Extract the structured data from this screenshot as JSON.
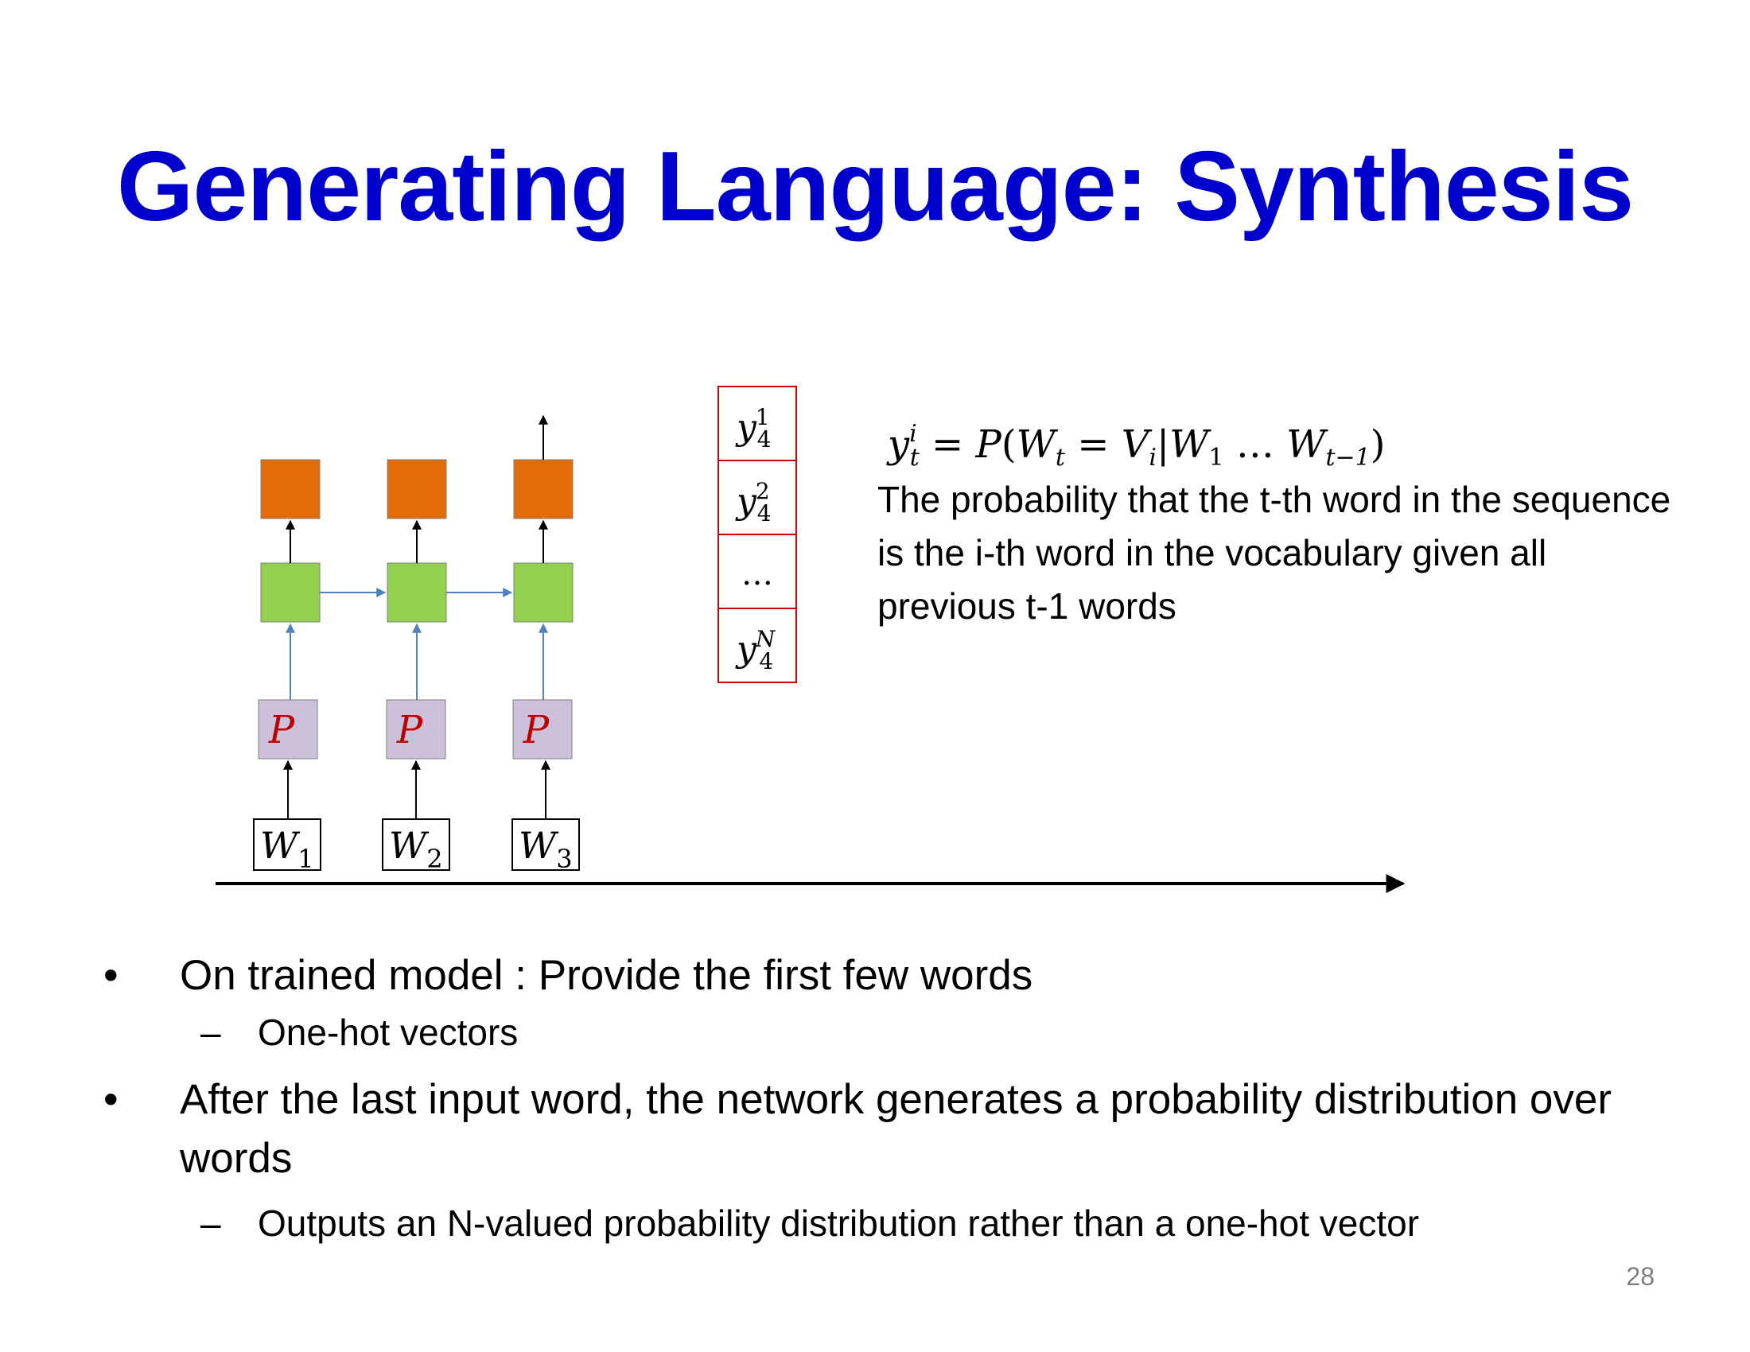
{
  "slide": {
    "title": "Generating Language: Synthesis",
    "page_number": "28"
  },
  "diagram": {
    "projection_label": "P",
    "inputs": [
      "W_1",
      "W_2",
      "W_3"
    ],
    "output_vector_entries": [
      "y_4^1",
      "y_4^2",
      "...",
      "y_4^N"
    ],
    "colors": {
      "output_box": "#e36c0a",
      "hidden_box": "#92d050",
      "projection_box": "#ccc0da",
      "projection_text": "#c00000",
      "blue_arrow": "#4f81bd",
      "output_vector_border": "#d40000"
    }
  },
  "formula": "y_t^i = P(W_t = V_i | W_1 ... W_{t-1})",
  "description": "The probability that the t-th word in the sequence is the i-th word in the vocabulary given all previous t-1 words",
  "bullets": [
    {
      "text": "On trained model : Provide the first few words",
      "sub": [
        "One-hot vectors"
      ]
    },
    {
      "text": "After the last input word, the network generates a probability distribution over words",
      "sub": [
        "Outputs an N-valued probability distribution rather than a one-hot vector"
      ]
    }
  ]
}
